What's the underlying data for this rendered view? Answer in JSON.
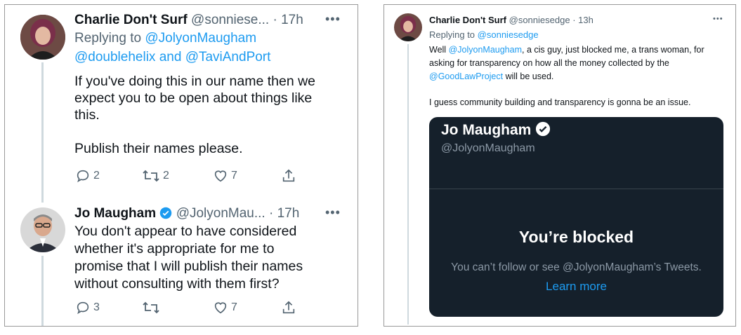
{
  "left": {
    "tweet1": {
      "name": "Charlie Don't Surf",
      "handle": "@sonniese...",
      "time": "· 17h",
      "more": "•••",
      "replying_to_prefix": "Replying to",
      "replying_to_1": "@JolyonMaugham",
      "replying_to_2": "@doublehelix",
      "and": "and",
      "replying_to_3": "@TaviAndPort",
      "body_lines": [
        "If you've doing this in our name then we",
        "expect you to be open about things like",
        "this.",
        "",
        "Publish their names please."
      ],
      "replies": "2",
      "retweets": "2",
      "likes": "7"
    },
    "tweet2": {
      "name": "Jo Maugham",
      "handle": "@JolyonMau...",
      "time": "· 17h",
      "more": "•••",
      "body_lines": [
        "You don't appear to have considered",
        "whether it's appropriate for me to",
        "promise that I will publish their names",
        "without consulting with them first?"
      ],
      "replies": "3",
      "retweets": "",
      "likes": "7"
    }
  },
  "right": {
    "name": "Charlie Don't Surf",
    "handle": "@sonniesedge",
    "time": "· 13h",
    "more": "•••",
    "replying_to_prefix": "Replying to",
    "replying_to": "@sonniesedge",
    "line1_pre": "Well",
    "line1_mention": "@JolyonMaugham",
    "line1_post": ", a cis guy, just blocked me, a trans woman, for",
    "line2": "asking for transparency on how all the money collected by the",
    "line3_mention": "@GoodLawProject",
    "line3_post": " will be used.",
    "line4": "I guess community building and transparency is gonna be an issue.",
    "card": {
      "name": "Jo Maugham",
      "handle": "@JolyonMaugham",
      "blocked_title": "You’re blocked",
      "blocked_text": "You can’t follow or see @JolyonMaugham’s Tweets.",
      "learn_more": "Learn more"
    }
  },
  "colors": {
    "link": "#1d9bf0",
    "secondary_text": "#536471",
    "card_bg": "#15202b",
    "verified": "#1d9bf0"
  }
}
